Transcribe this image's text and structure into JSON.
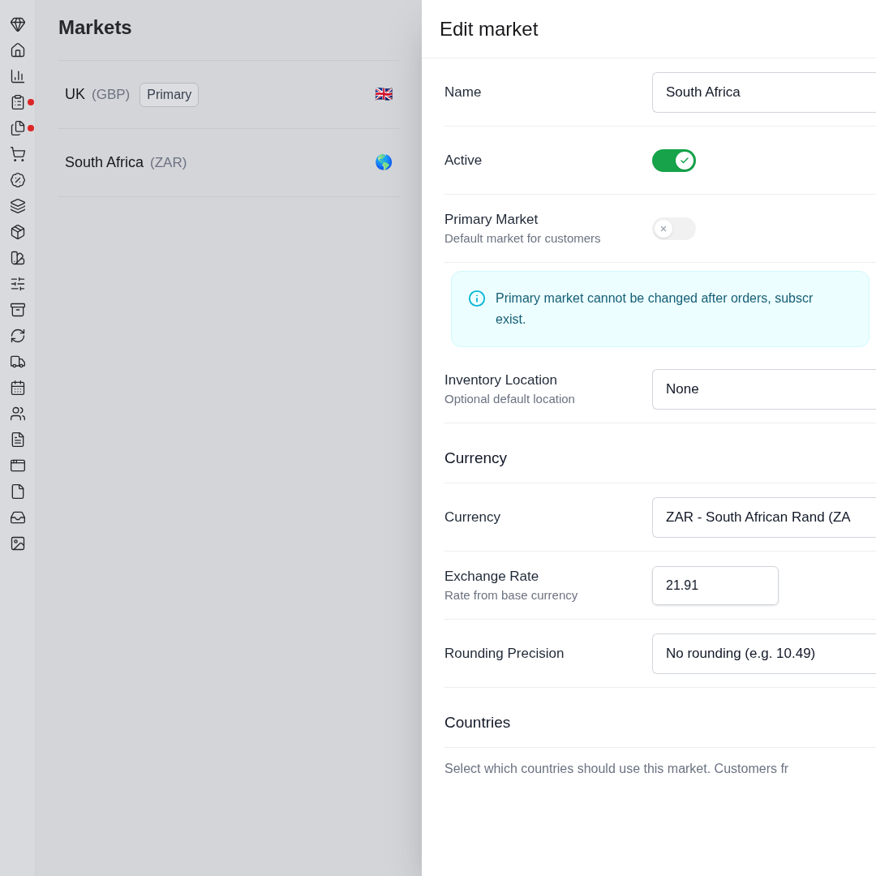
{
  "sidebar": {
    "nav": [
      {
        "dot": false
      },
      {
        "dot": false
      },
      {
        "dot": false
      },
      {
        "dot": true
      },
      {
        "dot": true
      },
      {
        "dot": false
      },
      {
        "dot": false
      },
      {
        "dot": false
      },
      {
        "dot": false
      },
      {
        "dot": false
      },
      {
        "dot": false
      },
      {
        "dot": false
      },
      {
        "dot": false
      },
      {
        "dot": false
      },
      {
        "dot": false
      },
      {
        "dot": false
      },
      {
        "dot": false
      },
      {
        "dot": false
      },
      {
        "dot": false
      },
      {
        "dot": false
      },
      {
        "dot": false
      }
    ]
  },
  "markets": {
    "title": "Markets",
    "rows": [
      {
        "name": "UK",
        "currency": "(GBP)",
        "badge": "Primary",
        "flag": "🇬🇧"
      },
      {
        "name": "South Africa",
        "currency": "(ZAR)",
        "flag": "🌎"
      }
    ]
  },
  "drawer": {
    "title": "Edit market",
    "sections": [
      {
        "fields": [
          {
            "kind": "text",
            "label": "Name",
            "value": "South Africa"
          },
          {
            "kind": "toggle",
            "label": "Active",
            "on": true
          },
          {
            "kind": "toggle",
            "label": "Primary Market",
            "hint": "Default market for customers",
            "on": false
          },
          {
            "kind": "alert",
            "lines": [
              "Primary market cannot be changed after orders, subscr",
              "exist."
            ]
          },
          {
            "kind": "select",
            "label": "Inventory Location",
            "hint": "Optional default location",
            "value": "None"
          }
        ]
      },
      {
        "heading": "Currency",
        "fields": [
          {
            "kind": "select",
            "label": "Currency",
            "value": "ZAR - South African Rand (ZA"
          },
          {
            "kind": "number",
            "label": "Exchange Rate",
            "hint": "Rate from base currency",
            "value": "21.91"
          },
          {
            "kind": "select",
            "label": "Rounding Precision",
            "value": "No rounding (e.g. 10.49)"
          }
        ]
      },
      {
        "heading": "Countries",
        "description": "Select which countries should use this market. Customers fr"
      }
    ]
  }
}
